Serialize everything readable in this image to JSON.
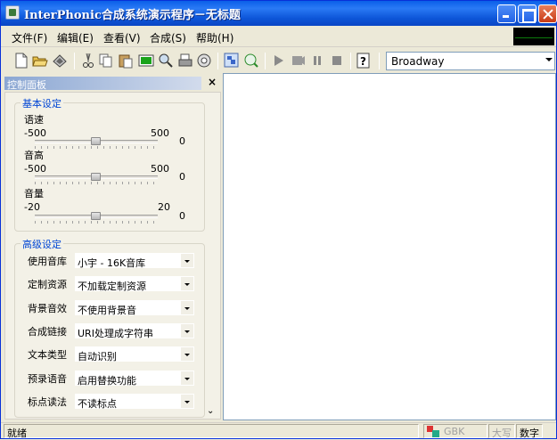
{
  "window": {
    "title": "InterPhonic合成系统演示程序－无标题"
  },
  "menu": {
    "items": [
      {
        "label": "文件(F)"
      },
      {
        "label": "编辑(E)"
      },
      {
        "label": "查看(V)"
      },
      {
        "label": "合成(S)"
      },
      {
        "label": "帮助(H)"
      }
    ]
  },
  "toolbar": {
    "icons": [
      "new-icon",
      "open-icon",
      "save-icon",
      "cut-icon",
      "copy-icon",
      "paste-icon",
      "screen-icon",
      "find-icon",
      "print-icon",
      "settings-icon",
      "voice-icon",
      "mtts-icon",
      "play-icon",
      "record-icon",
      "pause-icon",
      "stop-icon",
      "help-icon"
    ],
    "voice_select": "Broadway"
  },
  "panel": {
    "title": "控制面板",
    "basic": {
      "title": "基本设定",
      "sliders": [
        {
          "label": "语速",
          "min": "-500",
          "max": "500",
          "value": "0",
          "fraction": 0.5
        },
        {
          "label": "音高",
          "min": "-500",
          "max": "500",
          "value": "0",
          "fraction": 0.5
        },
        {
          "label": "音量",
          "min": "-20",
          "max": "20",
          "value": "0",
          "fraction": 0.5
        }
      ]
    },
    "advanced": {
      "title": "高级设定",
      "rows": [
        {
          "label": "使用音库",
          "value": "小宇 - 16K音库"
        },
        {
          "label": "定制资源",
          "value": "不加载定制资源"
        },
        {
          "label": "背景音效",
          "value": "不使用背景音"
        },
        {
          "label": "合成链接",
          "value": "URI处理成字符串"
        },
        {
          "label": "文本类型",
          "value": "自动识别"
        },
        {
          "label": "预录语音",
          "value": "启用替换功能"
        },
        {
          "label": "标点读法",
          "value": "不读标点"
        }
      ]
    }
  },
  "status": {
    "ready": "就绪",
    "encoding": "GBK",
    "caps": "大写",
    "num": "数字"
  },
  "colors": {
    "titlebar": "#0a5fe8",
    "group_title": "#0046d5",
    "panel_head": "#8ba7d3"
  }
}
